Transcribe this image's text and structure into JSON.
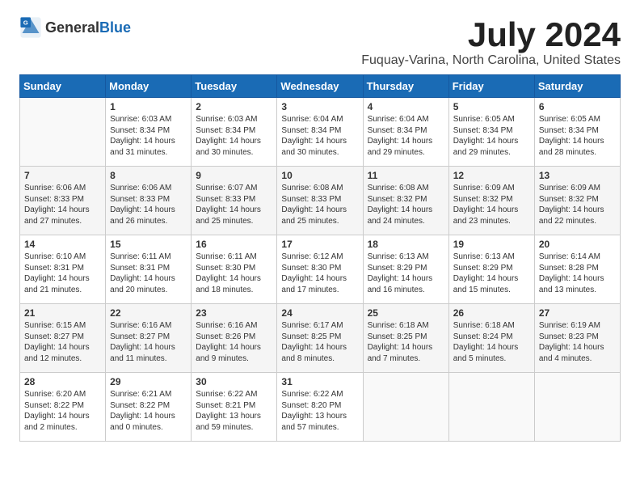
{
  "header": {
    "logo_general": "General",
    "logo_blue": "Blue",
    "month": "July 2024",
    "location": "Fuquay-Varina, North Carolina, United States"
  },
  "weekdays": [
    "Sunday",
    "Monday",
    "Tuesday",
    "Wednesday",
    "Thursday",
    "Friday",
    "Saturday"
  ],
  "weeks": [
    [
      {
        "day": "",
        "info": ""
      },
      {
        "day": "1",
        "info": "Sunrise: 6:03 AM\nSunset: 8:34 PM\nDaylight: 14 hours\nand 31 minutes."
      },
      {
        "day": "2",
        "info": "Sunrise: 6:03 AM\nSunset: 8:34 PM\nDaylight: 14 hours\nand 30 minutes."
      },
      {
        "day": "3",
        "info": "Sunrise: 6:04 AM\nSunset: 8:34 PM\nDaylight: 14 hours\nand 30 minutes."
      },
      {
        "day": "4",
        "info": "Sunrise: 6:04 AM\nSunset: 8:34 PM\nDaylight: 14 hours\nand 29 minutes."
      },
      {
        "day": "5",
        "info": "Sunrise: 6:05 AM\nSunset: 8:34 PM\nDaylight: 14 hours\nand 29 minutes."
      },
      {
        "day": "6",
        "info": "Sunrise: 6:05 AM\nSunset: 8:34 PM\nDaylight: 14 hours\nand 28 minutes."
      }
    ],
    [
      {
        "day": "7",
        "info": "Sunrise: 6:06 AM\nSunset: 8:33 PM\nDaylight: 14 hours\nand 27 minutes."
      },
      {
        "day": "8",
        "info": "Sunrise: 6:06 AM\nSunset: 8:33 PM\nDaylight: 14 hours\nand 26 minutes."
      },
      {
        "day": "9",
        "info": "Sunrise: 6:07 AM\nSunset: 8:33 PM\nDaylight: 14 hours\nand 25 minutes."
      },
      {
        "day": "10",
        "info": "Sunrise: 6:08 AM\nSunset: 8:33 PM\nDaylight: 14 hours\nand 25 minutes."
      },
      {
        "day": "11",
        "info": "Sunrise: 6:08 AM\nSunset: 8:32 PM\nDaylight: 14 hours\nand 24 minutes."
      },
      {
        "day": "12",
        "info": "Sunrise: 6:09 AM\nSunset: 8:32 PM\nDaylight: 14 hours\nand 23 minutes."
      },
      {
        "day": "13",
        "info": "Sunrise: 6:09 AM\nSunset: 8:32 PM\nDaylight: 14 hours\nand 22 minutes."
      }
    ],
    [
      {
        "day": "14",
        "info": "Sunrise: 6:10 AM\nSunset: 8:31 PM\nDaylight: 14 hours\nand 21 minutes."
      },
      {
        "day": "15",
        "info": "Sunrise: 6:11 AM\nSunset: 8:31 PM\nDaylight: 14 hours\nand 20 minutes."
      },
      {
        "day": "16",
        "info": "Sunrise: 6:11 AM\nSunset: 8:30 PM\nDaylight: 14 hours\nand 18 minutes."
      },
      {
        "day": "17",
        "info": "Sunrise: 6:12 AM\nSunset: 8:30 PM\nDaylight: 14 hours\nand 17 minutes."
      },
      {
        "day": "18",
        "info": "Sunrise: 6:13 AM\nSunset: 8:29 PM\nDaylight: 14 hours\nand 16 minutes."
      },
      {
        "day": "19",
        "info": "Sunrise: 6:13 AM\nSunset: 8:29 PM\nDaylight: 14 hours\nand 15 minutes."
      },
      {
        "day": "20",
        "info": "Sunrise: 6:14 AM\nSunset: 8:28 PM\nDaylight: 14 hours\nand 13 minutes."
      }
    ],
    [
      {
        "day": "21",
        "info": "Sunrise: 6:15 AM\nSunset: 8:27 PM\nDaylight: 14 hours\nand 12 minutes."
      },
      {
        "day": "22",
        "info": "Sunrise: 6:16 AM\nSunset: 8:27 PM\nDaylight: 14 hours\nand 11 minutes."
      },
      {
        "day": "23",
        "info": "Sunrise: 6:16 AM\nSunset: 8:26 PM\nDaylight: 14 hours\nand 9 minutes."
      },
      {
        "day": "24",
        "info": "Sunrise: 6:17 AM\nSunset: 8:25 PM\nDaylight: 14 hours\nand 8 minutes."
      },
      {
        "day": "25",
        "info": "Sunrise: 6:18 AM\nSunset: 8:25 PM\nDaylight: 14 hours\nand 7 minutes."
      },
      {
        "day": "26",
        "info": "Sunrise: 6:18 AM\nSunset: 8:24 PM\nDaylight: 14 hours\nand 5 minutes."
      },
      {
        "day": "27",
        "info": "Sunrise: 6:19 AM\nSunset: 8:23 PM\nDaylight: 14 hours\nand 4 minutes."
      }
    ],
    [
      {
        "day": "28",
        "info": "Sunrise: 6:20 AM\nSunset: 8:22 PM\nDaylight: 14 hours\nand 2 minutes."
      },
      {
        "day": "29",
        "info": "Sunrise: 6:21 AM\nSunset: 8:22 PM\nDaylight: 14 hours\nand 0 minutes."
      },
      {
        "day": "30",
        "info": "Sunrise: 6:22 AM\nSunset: 8:21 PM\nDaylight: 13 hours\nand 59 minutes."
      },
      {
        "day": "31",
        "info": "Sunrise: 6:22 AM\nSunset: 8:20 PM\nDaylight: 13 hours\nand 57 minutes."
      },
      {
        "day": "",
        "info": ""
      },
      {
        "day": "",
        "info": ""
      },
      {
        "day": "",
        "info": ""
      }
    ]
  ]
}
